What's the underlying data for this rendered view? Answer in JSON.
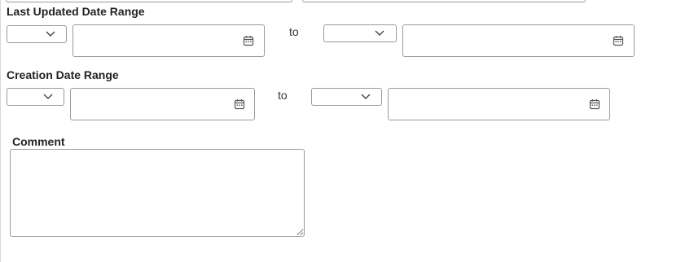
{
  "last_updated": {
    "label": "Last Updated Date Range",
    "to_label": "to",
    "from_operator": "",
    "from_date": "",
    "to_operator": "",
    "to_date": ""
  },
  "creation": {
    "label": "Creation Date Range",
    "to_label": "to",
    "from_operator": "",
    "from_date": "",
    "to_operator": "",
    "to_date": ""
  },
  "comment": {
    "label": "Comment",
    "value": ""
  }
}
